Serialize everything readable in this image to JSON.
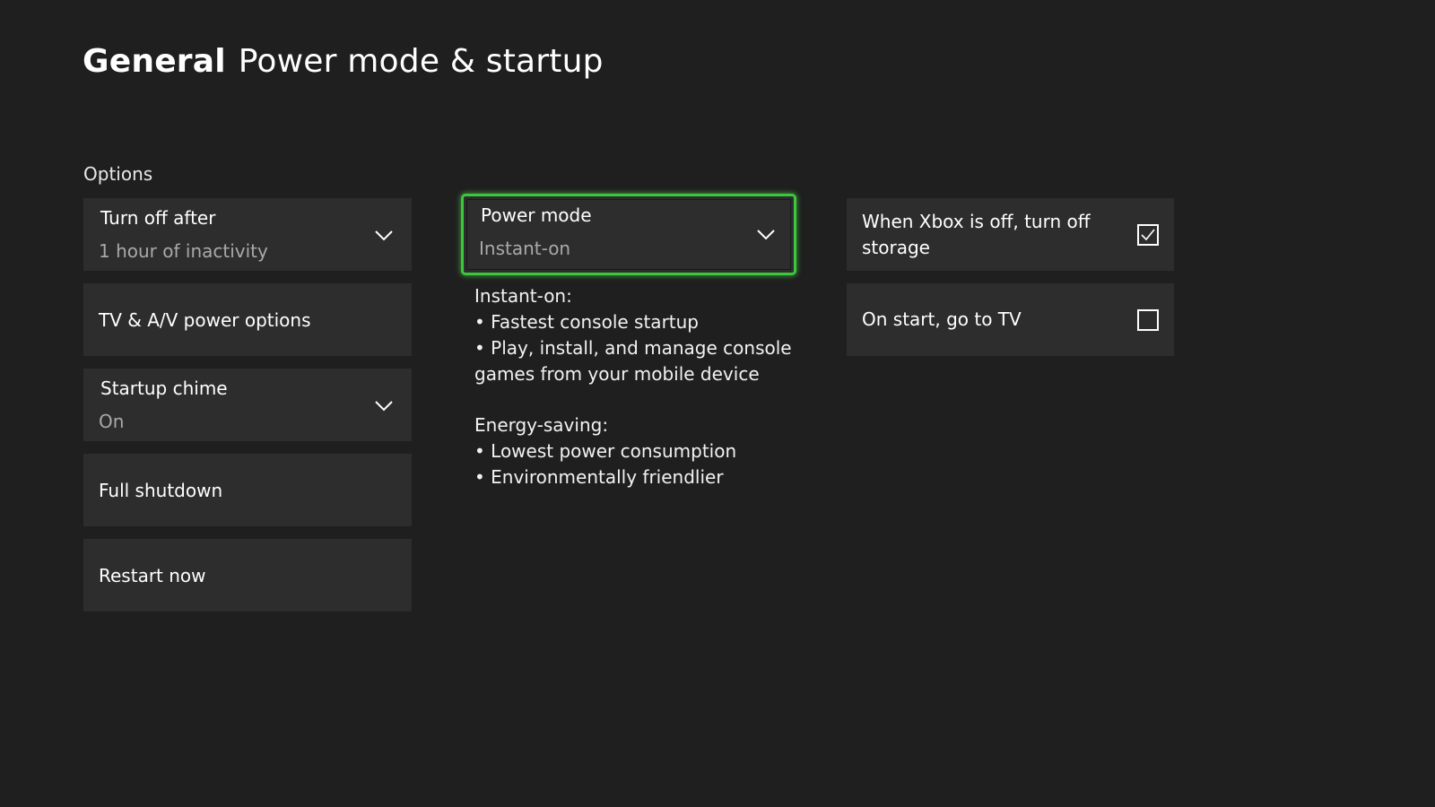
{
  "header": {
    "section": "General",
    "page": "Power mode & startup"
  },
  "options_label": "Options",
  "left_column": {
    "turn_off_after": {
      "label": "Turn off after",
      "value": "1 hour of inactivity"
    },
    "tv_av_power": {
      "label": "TV & A/V power options"
    },
    "startup_chime": {
      "label": "Startup chime",
      "value": "On"
    },
    "full_shutdown": {
      "label": "Full shutdown"
    },
    "restart_now": {
      "label": "Restart now"
    }
  },
  "power_mode": {
    "label": "Power mode",
    "value": "Instant-on",
    "focused": true,
    "focus_color": "#3cc83c"
  },
  "description": {
    "instant_on": {
      "heading": "Instant-on:",
      "bullets": [
        "• Fastest console startup",
        "• Play, install, and manage console games from your mobile device"
      ]
    },
    "energy_saving": {
      "heading": "Energy-saving:",
      "bullets": [
        "• Lowest power consumption",
        "• Environmentally friendlier"
      ]
    }
  },
  "right_column": {
    "storage_off": {
      "label": "When Xbox is off, turn off storage",
      "checked": true
    },
    "start_tv": {
      "label": "On start, go to TV",
      "checked": false
    }
  },
  "icons": {
    "dropdown": "chevron-down-icon",
    "checked": "checkmark-icon"
  },
  "colors": {
    "background": "#1f1f1f",
    "tile": "#2d2d2d",
    "accent": "#3cc83c",
    "secondary_text": "#a9a9a9"
  }
}
